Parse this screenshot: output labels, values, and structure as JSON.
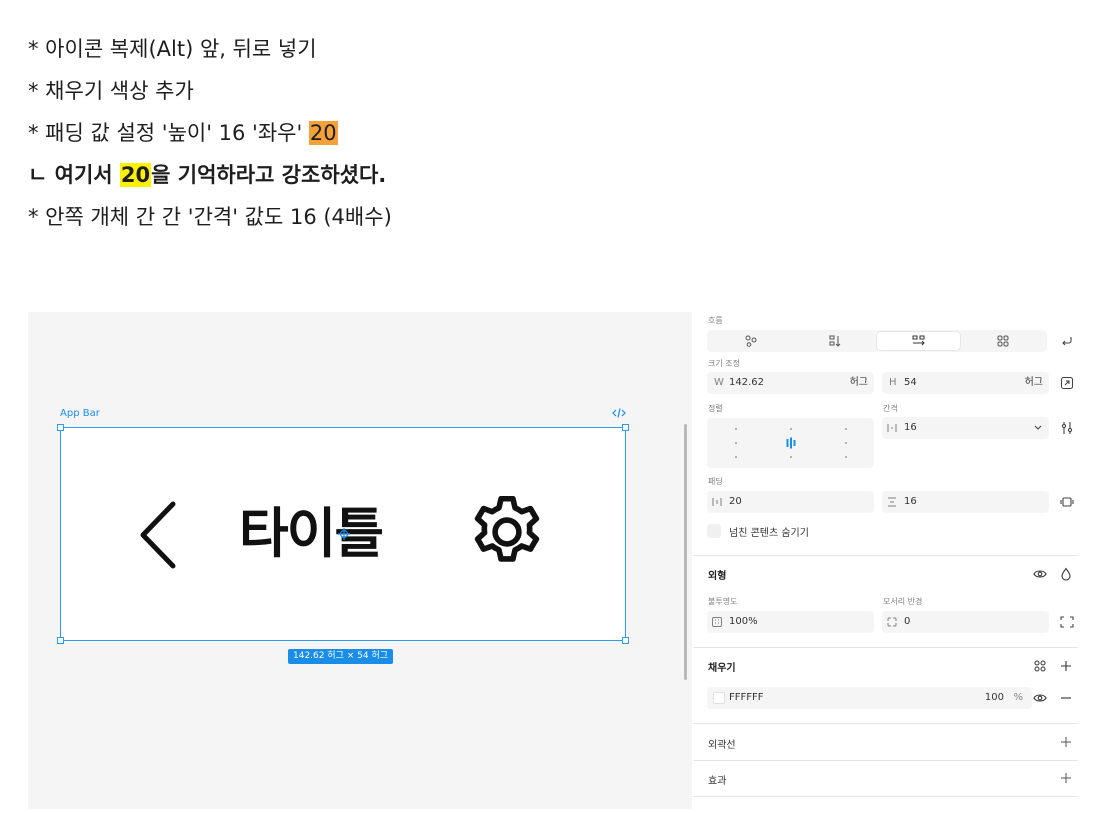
{
  "notes": {
    "line1": "* 아이콘 복제(Alt) 앞, 뒤로 넣기",
    "line2": "* 채우기 색상 추가",
    "line3_prefix": "* 패딩 값 설정 '높이' 16 '좌우' ",
    "line3_highlight": "20",
    "line4_prefix": "ㄴ 여기서 ",
    "line4_highlight": "20",
    "line4_suffix": "을 기억하라고 강조하셨다.",
    "line5": "* 안쪽 개체 간 간 '간격' 값도 16 (4배수)",
    "highlight_orange": "#f4a13a",
    "highlight_yellow": "#fff200"
  },
  "canvas": {
    "frame_label": "App Bar",
    "frame_title": "타이틀",
    "size_badge": "142.62 허그 × 54 허그",
    "selection_color": "#1a8de8",
    "icons": [
      "code-icon",
      "chevron-left-icon",
      "gear-icon"
    ]
  },
  "panel": {
    "flow_label": "흐름",
    "flow_options": [
      "free-form-icon",
      "vertical-icon",
      "horizontal-icon",
      "grid-icon"
    ],
    "flow_active": "horizontal-icon",
    "resize_label": "크기 조정",
    "width": {
      "key": "W",
      "value": "142.62",
      "mode": "허그"
    },
    "height": {
      "key": "H",
      "value": "54",
      "mode": "허그"
    },
    "align_label": "정렬",
    "gap_label": "간격",
    "gap_value": "16",
    "padding_label": "패딩",
    "padding_horizontal": "20",
    "padding_vertical": "16",
    "clip_content_label": "넘친 콘텐츠 숨기기",
    "appearance_title": "외형",
    "opacity_label": "불투명도",
    "opacity_value": "100%",
    "radius_label": "모서리 반경",
    "radius_value": "0",
    "fill_title": "채우기",
    "fill_hex": "FFFFFF",
    "fill_opacity": "100",
    "fill_opacity_unit": "%",
    "stroke_title": "외곽선",
    "effects_title": "효과"
  }
}
